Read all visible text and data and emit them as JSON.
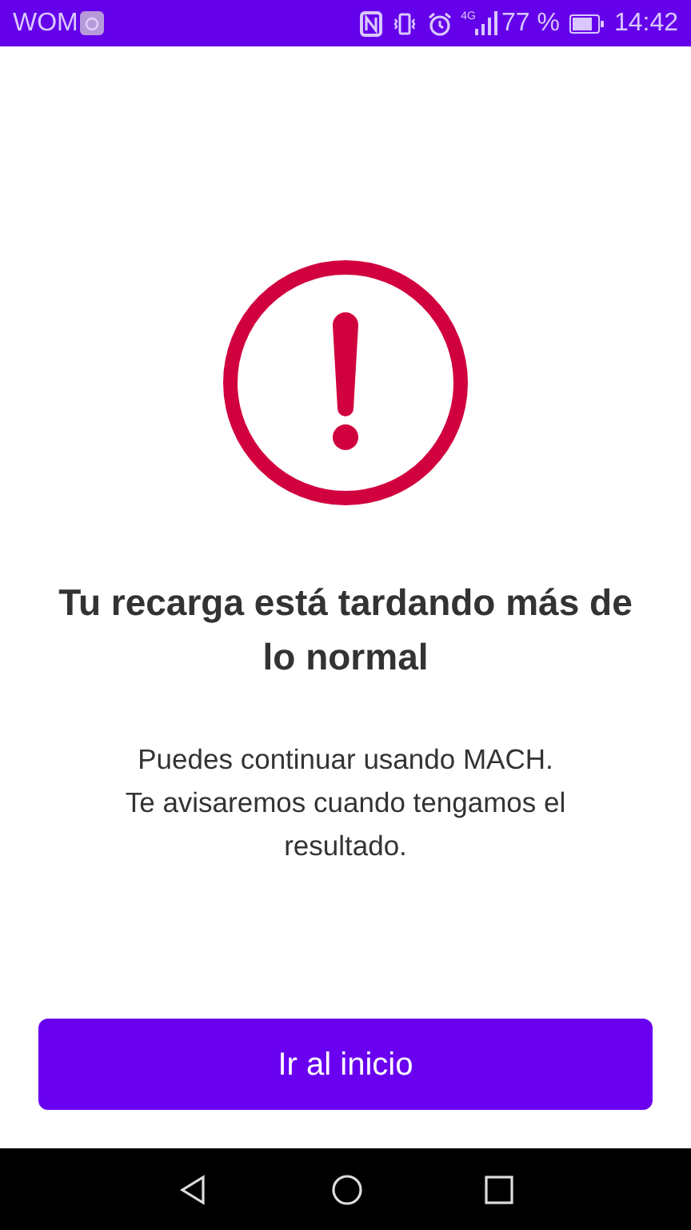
{
  "status_bar": {
    "carrier": "WOM",
    "network": "4G",
    "battery": "77 %",
    "time": "14:42"
  },
  "alert": {
    "title": "Tu recarga está tardando más de lo normal",
    "message": [
      "Puedes continuar usando MACH.",
      "Te avisaremos cuando tengamos el resultado."
    ]
  },
  "button": {
    "label": "Ir al inicio"
  }
}
